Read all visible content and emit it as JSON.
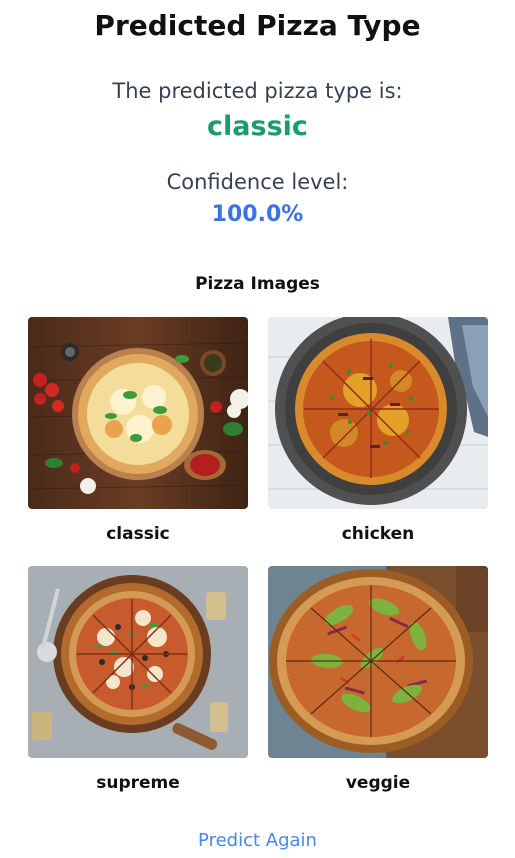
{
  "page": {
    "title": "Predicted Pizza Type"
  },
  "prediction": {
    "label": "The predicted pizza type is:",
    "value": "classic",
    "value_color": "#1a9c6b"
  },
  "confidence": {
    "label": "Confidence level:",
    "value": "100.0%",
    "value_color": "#3b73e0"
  },
  "images_section": {
    "title": "Pizza Images",
    "items": [
      {
        "caption": "classic",
        "image": "classic-margherita-pizza-photo"
      },
      {
        "caption": "chicken",
        "image": "bbq-chicken-pizza-photo"
      },
      {
        "caption": "supreme",
        "image": "supreme-pizza-photo"
      },
      {
        "caption": "veggie",
        "image": "veggie-avocado-pizza-photo"
      }
    ]
  },
  "actions": {
    "predict_again": "Predict Again",
    "link_color": "#4a86e8"
  }
}
